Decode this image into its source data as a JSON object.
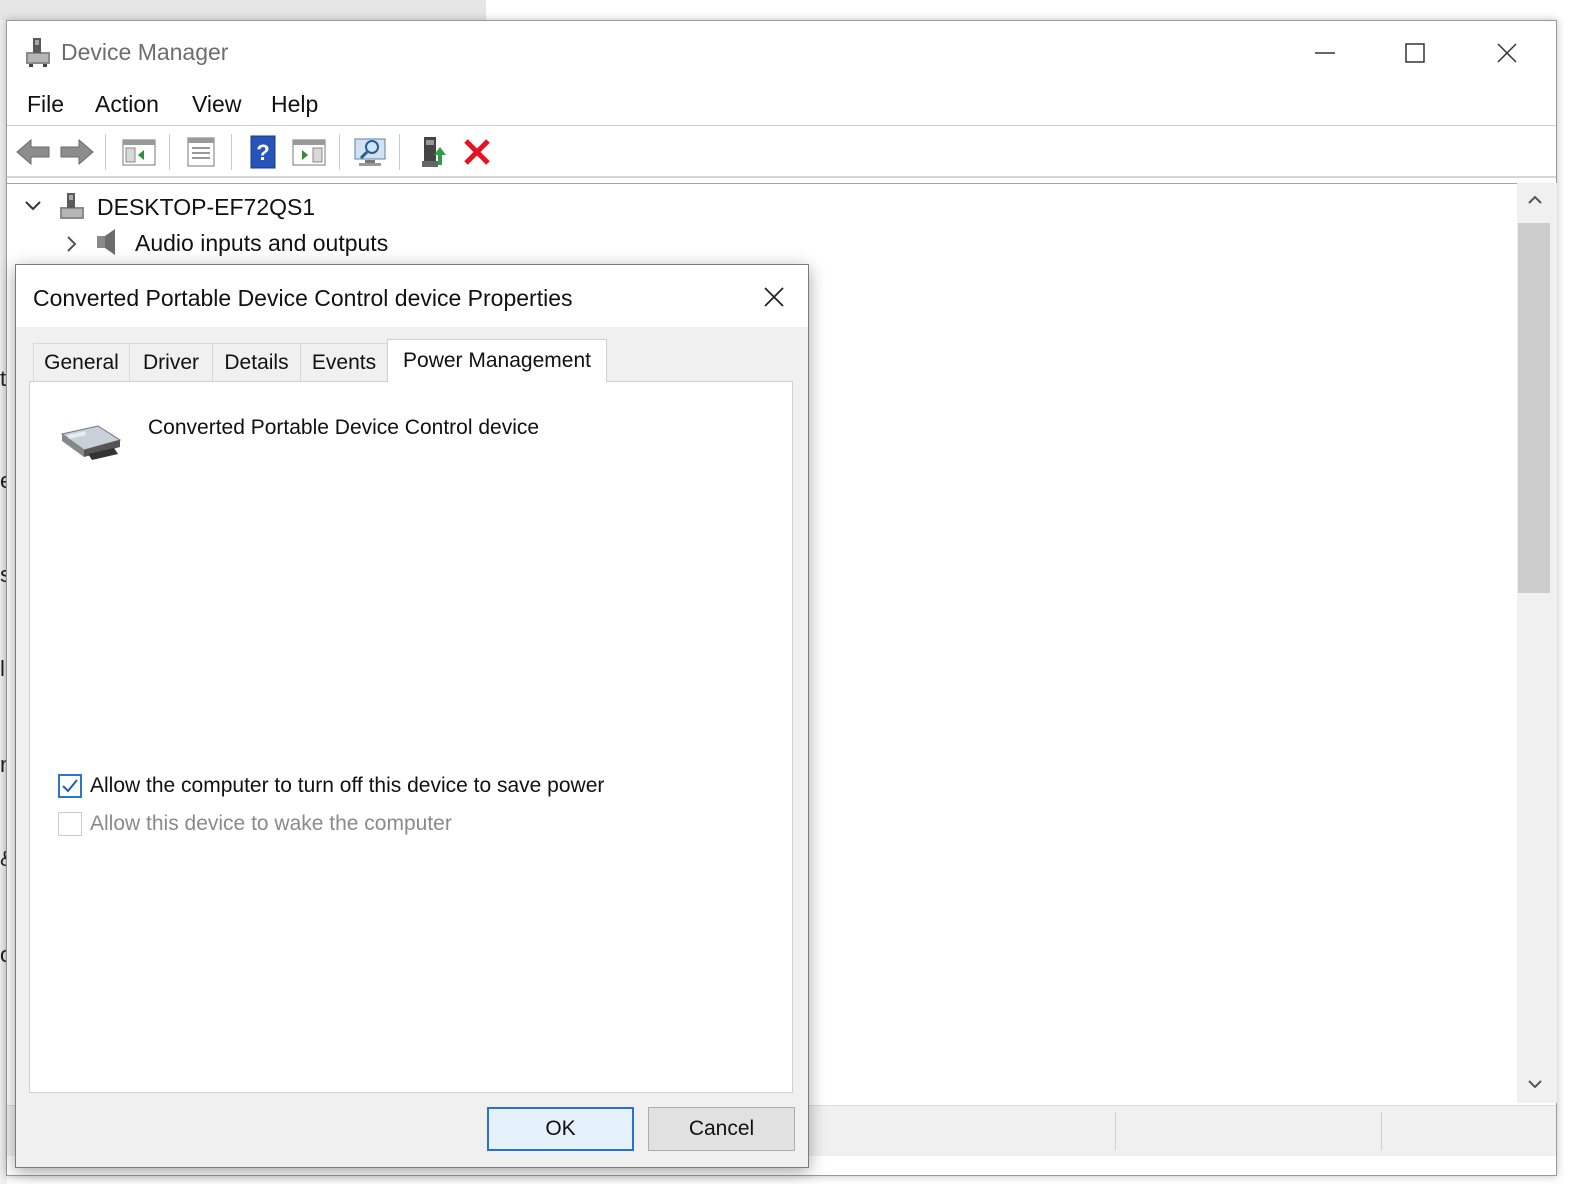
{
  "window": {
    "title": "Device Manager",
    "menu": [
      "File",
      "Action",
      "View",
      "Help"
    ],
    "toolbar_icons": [
      "back-arrow-icon",
      "forward-arrow-icon",
      "show-hide-console-tree-icon",
      "properties-icon",
      "help-icon",
      "action-pane-icon",
      "scan-hardware-icon",
      "update-driver-icon",
      "uninstall-device-icon"
    ]
  },
  "tree": {
    "root": "DESKTOP-EF72QS1",
    "items": [
      {
        "label": "Audio inputs and outputs"
      }
    ]
  },
  "background_letters": [
    "t",
    "e",
    "s",
    "l",
    "n",
    "&",
    "o"
  ],
  "dialog": {
    "title": "Converted Portable Device Control device Properties",
    "tabs": [
      "General",
      "Driver",
      "Details",
      "Events",
      "Power Management"
    ],
    "active_tab": "Power Management",
    "device_name": "Converted Portable Device Control device",
    "options": [
      {
        "label": "Allow the computer to turn off this device to save power",
        "checked": true,
        "enabled": true
      },
      {
        "label": "Allow this device to wake the computer",
        "checked": false,
        "enabled": false
      }
    ],
    "ok_label": "OK",
    "cancel_label": "Cancel"
  },
  "colors": {
    "accent": "#2a72c9",
    "uninstall_red": "#e81123"
  }
}
